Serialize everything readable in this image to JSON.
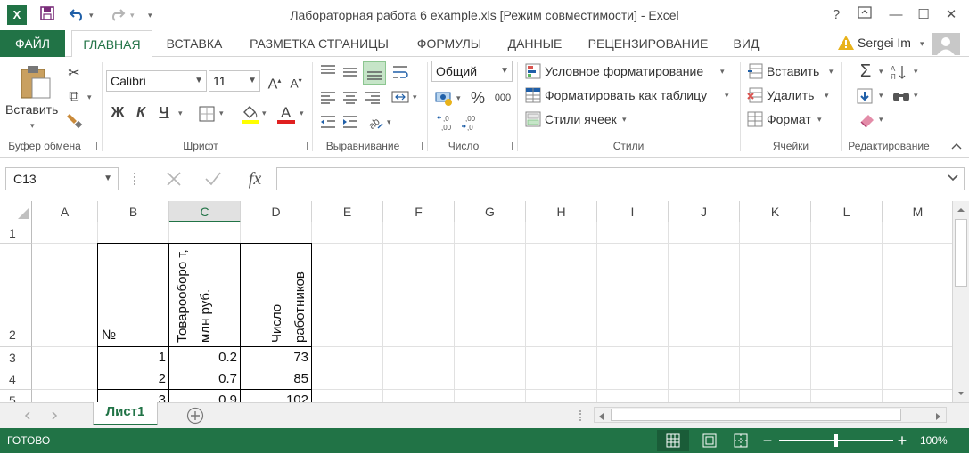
{
  "window": {
    "title": "Лабораторная работа 6 example.xls  [Режим совместимости] - Excel",
    "help": "?",
    "minimize": "—",
    "maximize": "☐",
    "close": "✕"
  },
  "qat": {
    "save_icon": "save-icon",
    "undo_icon": "undo-icon",
    "redo_icon": "redo-icon"
  },
  "tabs": [
    {
      "label": "ФАЙЛ"
    },
    {
      "label": "ГЛАВНАЯ"
    },
    {
      "label": "ВСТАВКА"
    },
    {
      "label": "РАЗМЕТКА СТРАНИЦЫ"
    },
    {
      "label": "ФОРМУЛЫ"
    },
    {
      "label": "ДАННЫЕ"
    },
    {
      "label": "РЕЦЕНЗИРОВАНИЕ"
    },
    {
      "label": "ВИД"
    }
  ],
  "user": {
    "name": "Sergei Im"
  },
  "ribbon": {
    "clipboard": {
      "paste": "Вставить",
      "label": "Буфер обмена"
    },
    "font": {
      "name": "Calibri",
      "size": "11",
      "bold": "Ж",
      "italic": "К",
      "underline": "Ч",
      "label": "Шрифт"
    },
    "alignment": {
      "label": "Выравнивание"
    },
    "number": {
      "format": "Общий",
      "percent": "%",
      "thousands": "000",
      "label": "Число"
    },
    "styles": {
      "conditional": "Условное форматирование",
      "as_table": "Форматировать как таблицу",
      "cell_styles": "Стили ячеек",
      "label": "Стили"
    },
    "cells": {
      "insert": "Вставить",
      "delete": "Удалить",
      "format": "Формат",
      "label": "Ячейки"
    },
    "editing": {
      "label": "Редактирование"
    }
  },
  "formula_bar": {
    "name_box": "C13",
    "fx": "fx",
    "value": ""
  },
  "columns": [
    "A",
    "B",
    "C",
    "D",
    "E",
    "F",
    "G",
    "H",
    "I",
    "J",
    "K",
    "L",
    "M"
  ],
  "rows": [
    "1",
    "2",
    "3",
    "4",
    "5"
  ],
  "cells": {
    "B2": "№",
    "C2": "Товарооборо т, млн руб.",
    "D2": "Число работников",
    "B3": "1",
    "C3": "0.2",
    "D3": "73",
    "B4": "2",
    "C4": "0.7",
    "D4": "85",
    "B5": "3",
    "C5": "0.9",
    "D5": "102"
  },
  "sheets": [
    {
      "label": "Лист1"
    }
  ],
  "status": {
    "text": "ГОТОВО",
    "zoom": "100%"
  },
  "colors": {
    "accent": "#217346",
    "selected_header_bg": "#e1e1e1"
  }
}
